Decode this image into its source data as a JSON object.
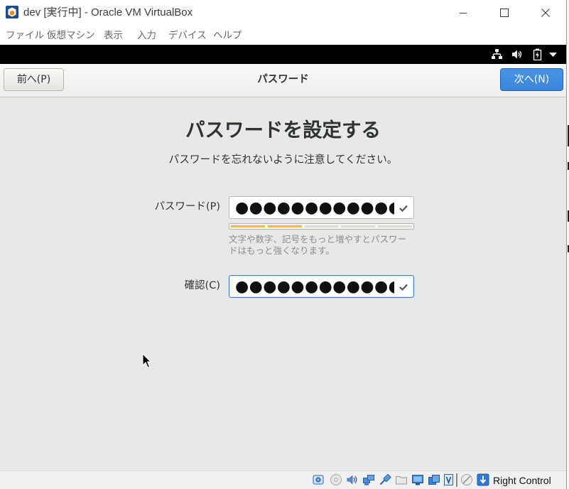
{
  "window": {
    "title": "dev [実行中] - Oracle VM VirtualBox"
  },
  "menu": {
    "items": [
      "ファイル",
      "仮想マシン",
      "表示",
      "入力",
      "デバイス",
      "ヘルプ"
    ]
  },
  "header": {
    "back_label": "前へ(P)",
    "title": "パスワード",
    "next_label": "次へ(N)"
  },
  "page": {
    "heading": "パスワードを設定する",
    "subtitle": "パスワードを忘れないように注意してください。",
    "password": {
      "label": "パスワード(P)",
      "value": "●●●●●●●●●●●●",
      "valid": true
    },
    "strength": {
      "level": 2,
      "max": 5,
      "hint": "文字や数字、記号をもっと増やすとパスワードはもっと強くなります。"
    },
    "confirm": {
      "label": "確認(C)",
      "value": "●●●●●●●●●●●●",
      "valid": true,
      "focused": true
    }
  },
  "status_bar": {
    "host_key": "Right Control"
  },
  "icons": {
    "title_bar": [
      "virtualbox-app-icon",
      "minimize-icon",
      "maximize-icon",
      "close-icon"
    ],
    "guest_top_bar": [
      "network-wired-icon",
      "volume-icon",
      "battery-icon",
      "system-menu-arrow-icon"
    ],
    "status_bar": [
      "hard-disk-icon",
      "optical-drive-icon",
      "audio-icon",
      "network-icon",
      "usb-icon",
      "shared-folders-icon",
      "display-icon",
      "recording-icon",
      "cpu-virtualization-icon",
      "mouse-integration-icon",
      "keyboard-capture-icon"
    ]
  },
  "colors": {
    "accent": "#3a86dc",
    "strength_fill": "#f2c30c",
    "page_background": "#e8e8e7",
    "guest_top_bar": "#000000"
  }
}
